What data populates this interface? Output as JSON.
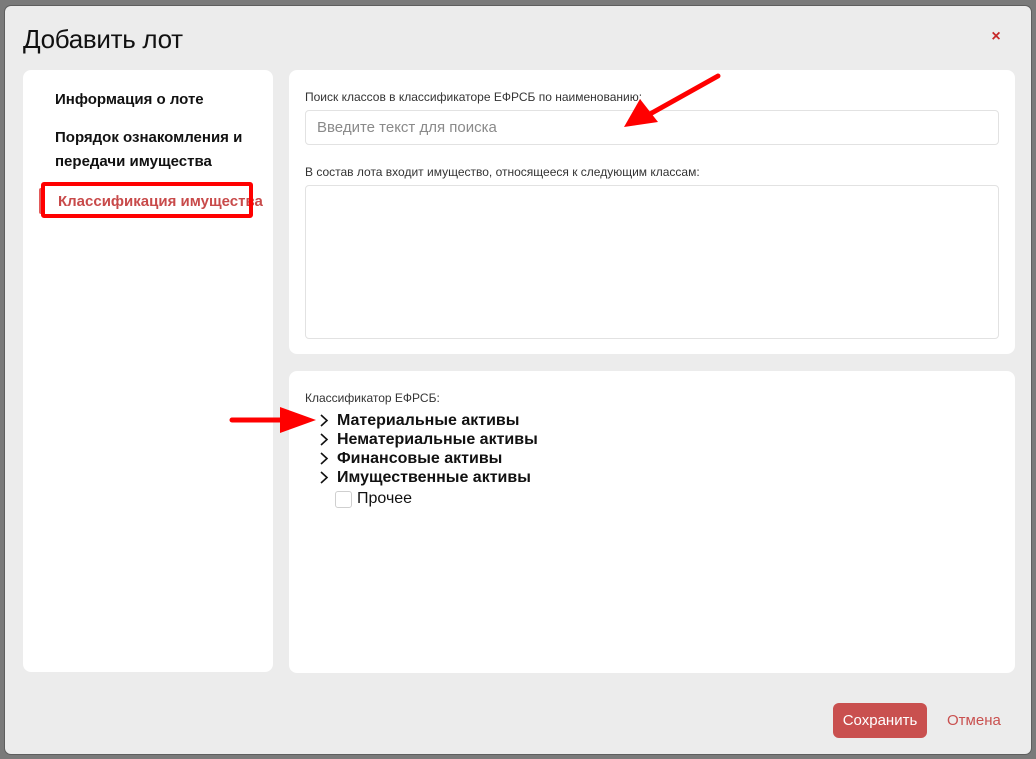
{
  "dialog": {
    "title": "Добавить лот",
    "close_symbol": "×"
  },
  "sidebar": {
    "items": [
      {
        "label": "Информация о лоте",
        "active": false
      },
      {
        "label": "Порядок ознакомления и передачи имущества",
        "active": false
      },
      {
        "label": "Классификация имущества",
        "active": true
      }
    ]
  },
  "search": {
    "label": "Поиск классов в классификаторе ЕФРСБ по наименованию:",
    "placeholder": "Введите текст для поиска",
    "value": ""
  },
  "selected_classes": {
    "label": "В состав лота входит имущество, относящееся к следующим классам:"
  },
  "classifier": {
    "label": "Классификатор ЕФРСБ:",
    "nodes": [
      {
        "label": "Материальные активы",
        "icon": "chevron-right-icon"
      },
      {
        "label": "Нематериальные активы",
        "icon": "chevron-right-icon"
      },
      {
        "label": "Финансовые активы",
        "icon": "chevron-right-icon"
      },
      {
        "label": "Имущественные активы",
        "icon": "chevron-right-icon"
      }
    ],
    "leaf": {
      "label": "Прочее",
      "checked": false
    }
  },
  "footer": {
    "save_label": "Сохранить",
    "cancel_label": "Отмена"
  },
  "colors": {
    "accent": "#c9504f",
    "annotation": "#ff0000"
  }
}
